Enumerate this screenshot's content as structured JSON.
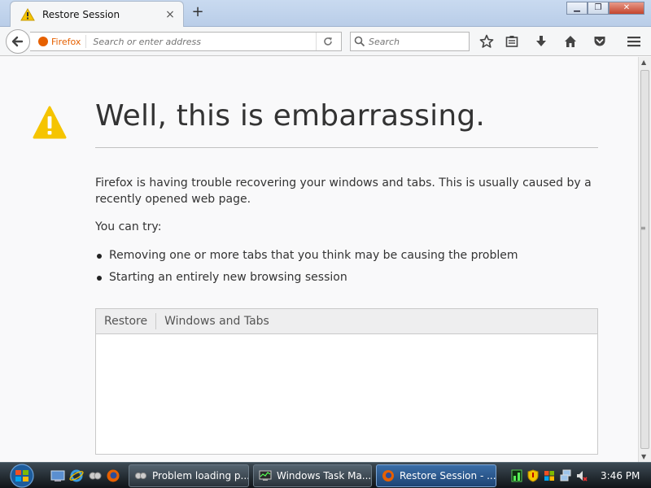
{
  "tab": {
    "title": "Restore Session",
    "close": "×"
  },
  "newtab": "+",
  "window": {
    "minimize": "▁",
    "maximize": "❐",
    "close": "✕"
  },
  "navbar": {
    "identity_label": "Firefox",
    "url_placeholder": "Search or enter address",
    "search_placeholder": "Search"
  },
  "page": {
    "heading": "Well, this is embarrassing.",
    "description": "Firefox is having trouble recovering your windows and tabs. This is usually caused by a recently opened web page.",
    "try_label": "You can try:",
    "suggestions": [
      "Removing one or more tabs that you think may be causing the problem",
      "Starting an entirely new browsing session"
    ],
    "tree_columns": [
      "Restore",
      "Windows and Tabs"
    ]
  },
  "taskbar": {
    "tasks": [
      {
        "label": "Problem loading p..."
      },
      {
        "label": "Windows Task Ma..."
      },
      {
        "label": "Restore Session - ..."
      }
    ],
    "clock": "3:46 PM"
  },
  "colors": {
    "warning": "#f5c400",
    "firefox_orange": "#e66000",
    "heading_text": "#333333",
    "active_task": "#3a6ea8"
  },
  "icons": {
    "tab": "warning-icon",
    "back": "back-arrow-icon",
    "reload": "reload-icon",
    "search": "magnifier-icon",
    "toolbar": [
      "bookmark-star-icon",
      "reading-list-icon",
      "download-icon",
      "home-icon",
      "pocket-icon",
      "hamburger-menu-icon"
    ],
    "quick_launch": [
      "show-desktop-icon",
      "internet-explorer-icon",
      "app-icon",
      "firefox-icon"
    ],
    "tray": [
      "network-meter-icon",
      "security-shield-icon",
      "windows-update-icon",
      "network-icon",
      "volume-muted-icon"
    ]
  }
}
